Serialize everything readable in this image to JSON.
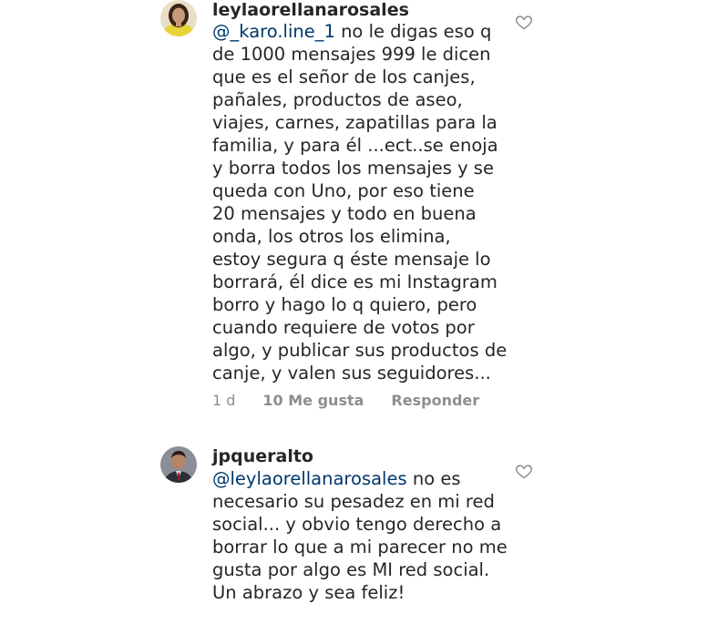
{
  "comments": [
    {
      "username": "leylaorellanarosales",
      "mention": "@_karo.line_1",
      "lines": [
        "no le digas eso q",
        "de 1000 mensajes 999 le dicen",
        "que es el señor de los canjes,",
        "pañales, productos de aseo,",
        "viajes, carnes, zapatillas para la",
        "familia, y para él ...ect..se enoja",
        "y borra todos los mensajes y se",
        "queda con Uno, por eso tiene",
        "20 mensajes y todo en buena",
        "onda, los otros los elimina,",
        "estoy segura q éste mensaje lo",
        "borrará, él dice es mi Instagram",
        "borro y hago lo q quiero, pero",
        "cuando requiere de votos por",
        "algo, y publicar sus productos de",
        "canje, y valen sus seguidores..."
      ],
      "time": "1 d",
      "likes": "10 Me gusta",
      "reply": "Responder",
      "like_icon": "heart-outline-icon"
    },
    {
      "username": "jpqueralto",
      "mention": "@leylaorellanarosales",
      "lines": [
        "no es",
        "necesario su pesadez en mi red",
        "social... y obvio tengo derecho a",
        "borrar lo que a mi parecer no me",
        "gusta por algo es MI red social.",
        "Un abrazo y sea feliz!"
      ],
      "like_icon": "heart-outline-icon"
    }
  ],
  "colors": {
    "text": "#262626",
    "mention": "#00376b",
    "secondary": "#8e8e8e"
  }
}
